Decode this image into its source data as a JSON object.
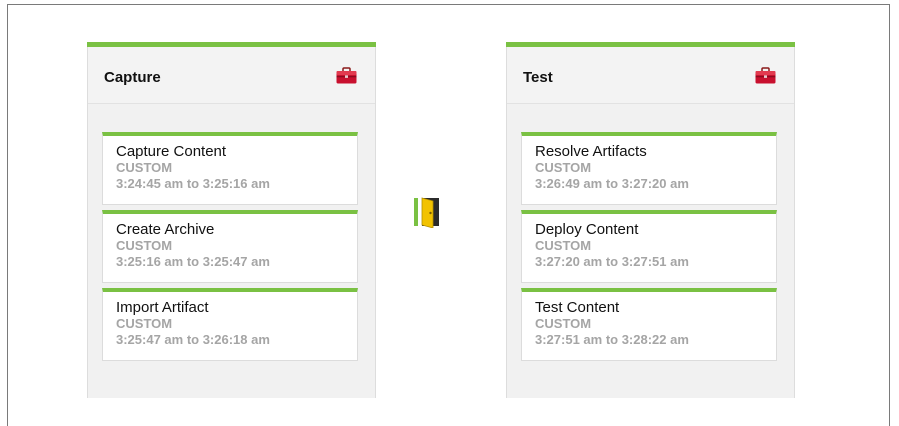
{
  "stages": [
    {
      "title": "Capture",
      "icon": "toolbox-icon",
      "tasks": [
        {
          "name": "Capture Content",
          "type": "CUSTOM",
          "time": "3:24:45 am to 3:25:16 am"
        },
        {
          "name": "Create Archive",
          "type": "CUSTOM",
          "time": "3:25:16 am to 3:25:47 am"
        },
        {
          "name": "Import Artifact",
          "type": "CUSTOM",
          "time": "3:25:47 am to 3:26:18 am"
        }
      ]
    },
    {
      "title": "Test",
      "icon": "toolbox-icon",
      "tasks": [
        {
          "name": "Resolve Artifacts",
          "type": "CUSTOM",
          "time": "3:26:49 am to 3:27:20 am"
        },
        {
          "name": "Deploy Content",
          "type": "CUSTOM",
          "time": "3:27:20 am to 3:27:51 am"
        },
        {
          "name": "Test Content",
          "type": "CUSTOM",
          "time": "3:27:51 am to 3:28:22 am"
        }
      ]
    }
  ],
  "transition_icon": "door-icon",
  "colors": {
    "accent_green": "#7ac143",
    "toolbox_red": "#c8102e",
    "door_yellow": "#f2c200",
    "muted_text": "#a5a5a5"
  }
}
